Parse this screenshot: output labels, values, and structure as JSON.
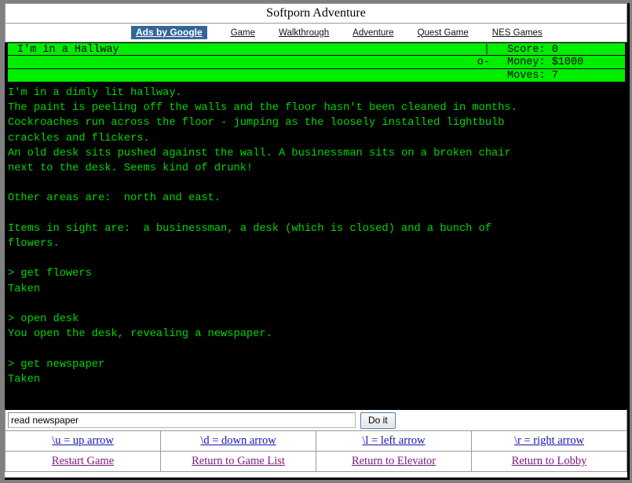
{
  "window": {
    "title": "Softporn Adventure"
  },
  "navbar": {
    "ads_badge": "Ads by Google",
    "links": [
      {
        "label": "Game"
      },
      {
        "label": "Walkthrough"
      },
      {
        "label": "Adventure"
      },
      {
        "label": "Quest Game"
      },
      {
        "label": "NES Games"
      }
    ]
  },
  "status": {
    "location": "I'm in a Hallway",
    "compass_row1": "|",
    "compass_row2": "o-",
    "compass_row3": "",
    "score_label": "Score: 0",
    "money_label": "Money: $1000",
    "moves_label": "Moves: 7"
  },
  "console": {
    "text": "I'm in a dimly lit hallway.\nThe paint is peeling off the walls and the floor hasn't been cleaned in months.\nCockroaches run across the floor - jumping as the loosely installed lightbulb\ncrackles and flickers.\nAn old desk sits pushed against the wall. A businessman sits on a broken chair\nnext to the desk. Seems kind of drunk!\n\nOther areas are:  north and east.\n\nItems in sight are:  a businessman, a desk (which is closed) and a bunch of\nflowers.\n\n> get flowers\nTaken\n\n> open desk\nYou open the desk, revealing a newspaper.\n\n> get newspaper\nTaken\n\n\n> ",
    "prompt_cursor": "_"
  },
  "input": {
    "value": "read newspaper",
    "placeholder": "",
    "submit_label": "Do it"
  },
  "arrow_links": [
    {
      "label": "\\u = up arrow"
    },
    {
      "label": "\\d = down arrow"
    },
    {
      "label": "\\l = left arrow"
    },
    {
      "label": "\\r = right arrow"
    }
  ],
  "nav_links": [
    {
      "label": "Restart Game"
    },
    {
      "label": "Return to Game List"
    },
    {
      "label": "Return to Elevator"
    },
    {
      "label": "Return to Lobby"
    }
  ],
  "colors": {
    "status_green": "#00ee00",
    "console_green": "#00d800",
    "console_bg": "#000000",
    "ads_blue": "#33669a",
    "link_blue": "#1414b4",
    "link_purple": "#7d187d"
  }
}
